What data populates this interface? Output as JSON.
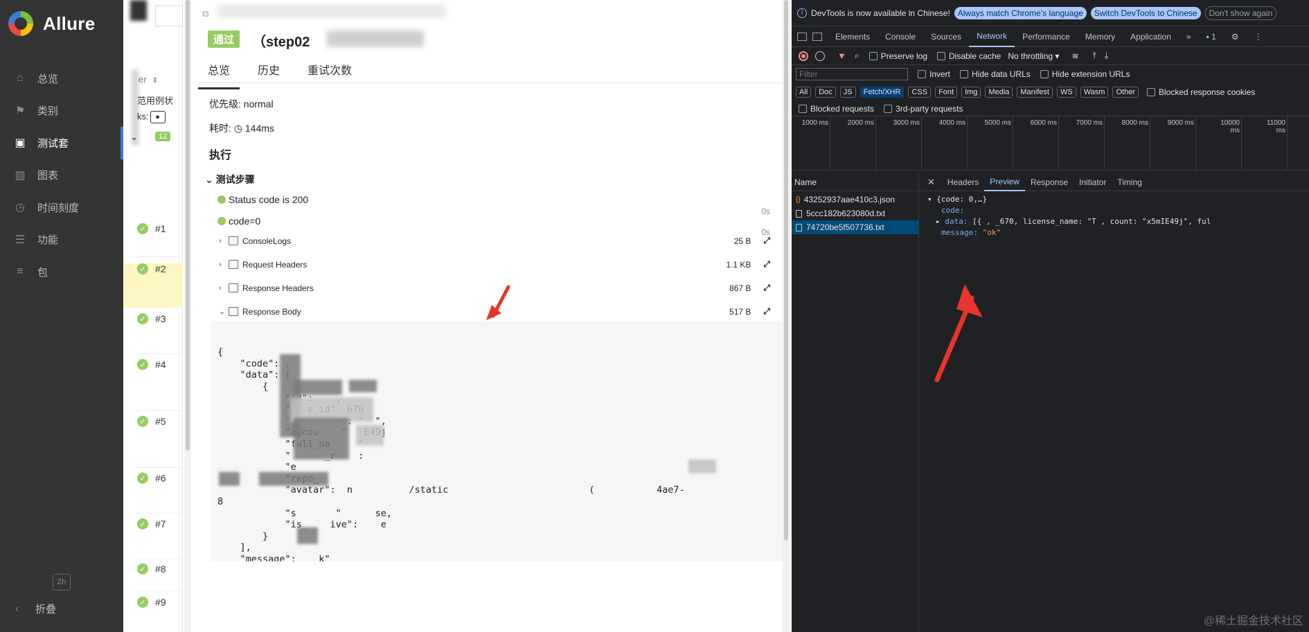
{
  "sidebar": {
    "brand": "Allure",
    "items": [
      {
        "label": "总览",
        "icon": "home-icon"
      },
      {
        "label": "类别",
        "icon": "flag-icon"
      },
      {
        "label": "测试套",
        "icon": "briefcase-icon"
      },
      {
        "label": "图表",
        "icon": "bar-chart-icon"
      },
      {
        "label": "时间刻度",
        "icon": "clock-icon"
      },
      {
        "label": "功能",
        "icon": "list-icon"
      },
      {
        "label": "包",
        "icon": "align-left-icon"
      }
    ],
    "lang": "Zh",
    "collapse": "折叠"
  },
  "list": {
    "sort_label": "er",
    "case_label": "范用例状",
    "links_label": "ks:",
    "count": "12",
    "rows": [
      "#1",
      "#2",
      "#3",
      "#4",
      "#5",
      "#6",
      "#7",
      "#8",
      "#9"
    ]
  },
  "detail": {
    "status": "通过",
    "title": "（step02",
    "tabs": [
      "总览",
      "历史",
      "重试次数"
    ],
    "priority": "优先级: normal",
    "duration_label": "耗时:",
    "duration": "144ms",
    "section": "执行",
    "steps_header": "测试步骤",
    "steps": [
      {
        "label": "Status code is 200",
        "duration": "0s"
      },
      {
        "label": "code=0",
        "duration": "0s"
      }
    ],
    "attachments": [
      {
        "name": "ConsoleLogs",
        "size": "25 B",
        "expanded": false
      },
      {
        "name": "Request Headers",
        "size": "1.1 KB",
        "expanded": false
      },
      {
        "name": "Response Headers",
        "size": "867 B",
        "expanded": false
      },
      {
        "name": "Response Body",
        "size": "517 B",
        "expanded": true
      }
    ],
    "code_lines": [
      "{",
      "    \"code\": ,",
      "    \"data\": [",
      "        {",
      "            \"id\":    ,",
      "            \"   e_id\"  670",
      "            \"         \": \"  \",",
      "            \"accou    \"   E49j",
      "            \"full_na     \"",
      "            \"      _r    :",
      "            \"e",
      "            \"repo_",
      "            \"avatar\":  n          /static                         (           4ae7-",
      "8  ",
      "            \"s       \"      se,",
      "            \"is_    ive\":    e",
      "        }",
      "    ],",
      "    \"message\":    k\"",
      "}"
    ]
  },
  "devtools": {
    "info": "DevTools is now available in Chinese!",
    "info_buttons": [
      "Always match Chrome's language",
      "Switch DevTools to Chinese",
      "Don't show again"
    ],
    "tabs": [
      "Elements",
      "Console",
      "Sources",
      "Network",
      "Performance",
      "Memory",
      "Application"
    ],
    "active_tab": "Network",
    "issues_count": "1",
    "toolbar": {
      "preserve_log": "Preserve log",
      "disable_cache": "Disable cache",
      "throttling": "No throttling"
    },
    "filter_placeholder": "Filter",
    "invert": "Invert",
    "hide_data_urls": "Hide data URLs",
    "hide_ext_urls": "Hide extension URLs",
    "types": [
      "All",
      "Doc",
      "JS",
      "Fetch/XHR",
      "CSS",
      "Font",
      "Img",
      "Media",
      "Manifest",
      "WS",
      "Wasm",
      "Other"
    ],
    "blocked_cookies": "Blocked response cookies",
    "blocked_requests": "Blocked requests",
    "third_party": "3rd-party requests",
    "timeline_ticks": [
      "1000 ms",
      "2000 ms",
      "3000 ms",
      "4000 ms",
      "5000 ms",
      "6000 ms",
      "7000 ms",
      "8000 ms",
      "9000 ms",
      "10000 ms",
      "11000 ms"
    ],
    "name_header": "Name",
    "requests": [
      "43252937aae410c3.json",
      "5ccc182b623080d.txt",
      "74720be5f507736.txt"
    ],
    "detail_tabs": [
      "Headers",
      "Preview",
      "Response",
      "Initiator",
      "Timing"
    ],
    "active_detail_tab": "Preview",
    "preview": {
      "root": "{code: 0,…}",
      "code_key": "code:",
      "data_key": "data:",
      "data_value": "[{         ,   _670,  license_name: \"T   ,  count: \"x5mIE49j\", ful",
      "message_key": "message:",
      "message_value": "\"ok\""
    }
  },
  "watermark": "@稀土掘金技术社区",
  "colors": {
    "passed": "#97cc64",
    "sidebar": "#343434",
    "devtools_bg": "#202124",
    "accent": "#a8c7fa",
    "arrow": "#e8342a"
  }
}
